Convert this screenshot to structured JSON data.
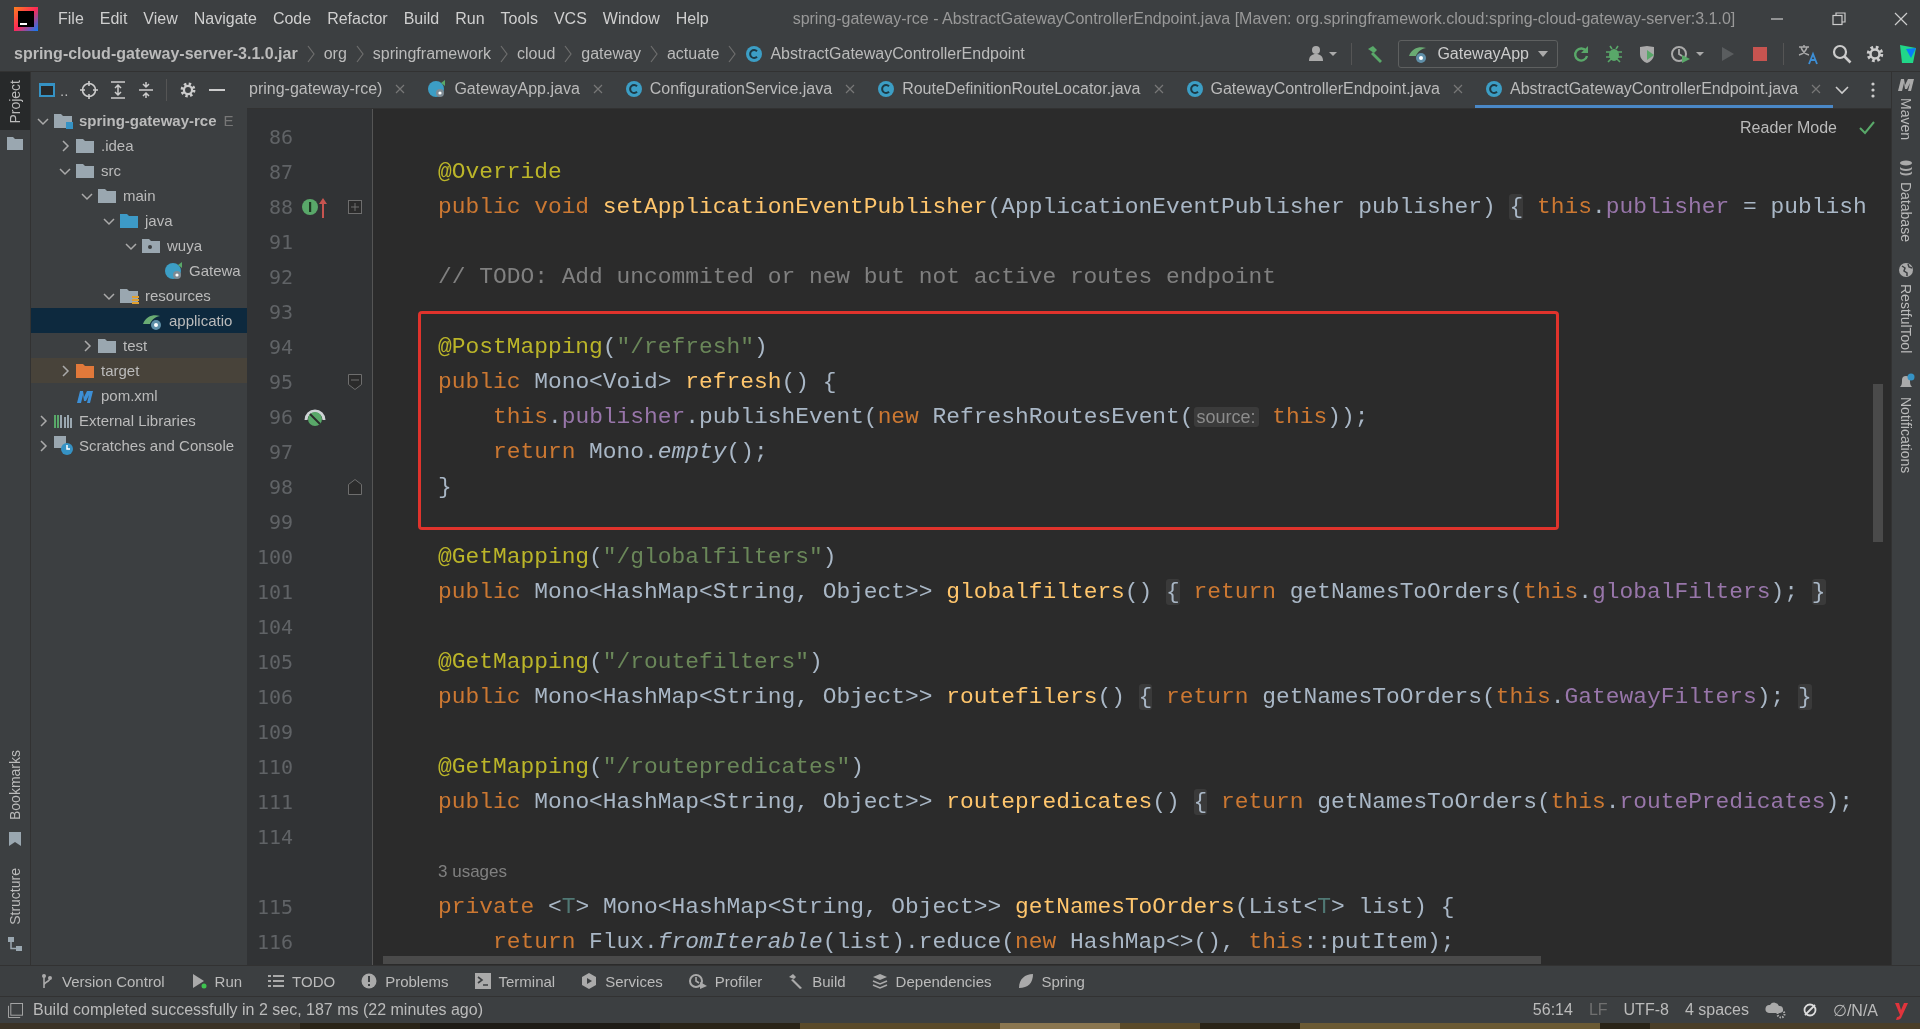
{
  "window": {
    "title": "spring-gateway-rce - AbstractGatewayControllerEndpoint.java [Maven: org.springframework.cloud:spring-cloud-gateway-server:3.1.0]"
  },
  "menu": [
    "File",
    "Edit",
    "View",
    "Navigate",
    "Code",
    "Refactor",
    "Build",
    "Run",
    "Tools",
    "VCS",
    "Window",
    "Help"
  ],
  "breadcrumb": [
    {
      "label": "spring-cloud-gateway-server-3.1.0.jar",
      "kind": "root"
    },
    {
      "label": "org",
      "kind": "package"
    },
    {
      "label": "springframework",
      "kind": "package"
    },
    {
      "label": "cloud",
      "kind": "package"
    },
    {
      "label": "gateway",
      "kind": "package"
    },
    {
      "label": "actuate",
      "kind": "package"
    },
    {
      "label": "AbstractGatewayControllerEndpoint",
      "kind": "class"
    }
  ],
  "run_config": {
    "label": "GatewayApp",
    "run_disabled": true
  },
  "left_strip": {
    "top": [
      {
        "label": "Project",
        "selected": true
      }
    ],
    "bottom": [
      {
        "label": "Bookmarks",
        "selected": false
      },
      {
        "label": "Structure",
        "selected": false
      }
    ]
  },
  "project_panel": {
    "title": "..",
    "tree": [
      {
        "label": "spring-gateway-rce",
        "path": "E",
        "kind": "module",
        "expanded": true,
        "selected": false,
        "children": [
          {
            "label": ".idea",
            "kind": "folder",
            "expanded": false,
            "selected": false
          },
          {
            "label": "src",
            "kind": "folder",
            "expanded": true,
            "selected": false,
            "children": [
              {
                "label": "main",
                "kind": "folder",
                "expanded": true,
                "selected": false,
                "children": [
                  {
                    "label": "java",
                    "kind": "source",
                    "expanded": true,
                    "selected": false,
                    "children": [
                      {
                        "label": "wuya",
                        "kind": "package",
                        "expanded": true,
                        "selected": false,
                        "children": [
                          {
                            "label": "Gatewa",
                            "kind": "app",
                            "selected": false
                          }
                        ]
                      }
                    ]
                  },
                  {
                    "label": "resources",
                    "kind": "resources",
                    "expanded": true,
                    "selected": false,
                    "children": [
                      {
                        "label": "applicatio",
                        "kind": "config",
                        "selected": true
                      }
                    ]
                  }
                ]
              },
              {
                "label": "test",
                "kind": "folder",
                "expanded": false,
                "selected": false
              }
            ]
          },
          {
            "label": "target",
            "kind": "excluded",
            "expanded": false,
            "selected": false
          },
          {
            "label": "pom.xml",
            "kind": "maven",
            "selected": false
          }
        ]
      },
      {
        "label": "External Libraries",
        "kind": "libraries",
        "expanded": false,
        "selected": false
      },
      {
        "label": "Scratches and Console",
        "kind": "scratches",
        "expanded": false,
        "selected": false
      }
    ]
  },
  "tabs": [
    {
      "label": "pring-gateway-rce)",
      "kind": "plain",
      "selected": false
    },
    {
      "label": "GatewayApp.java",
      "kind": "app",
      "selected": false
    },
    {
      "label": "ConfigurationService.java",
      "kind": "class",
      "selected": false
    },
    {
      "label": "RouteDefinitionRouteLocator.java",
      "kind": "class",
      "selected": false
    },
    {
      "label": "GatewayControllerEndpoint.java",
      "kind": "class",
      "selected": false
    },
    {
      "label": "AbstractGatewayControllerEndpoint.java",
      "kind": "class",
      "selected": true
    }
  ],
  "reader_mode": "Reader Mode",
  "code": {
    "lines": [
      {
        "kind": "code",
        "number": "86",
        "boxed": false
      },
      {
        "kind": "code",
        "number": "87",
        "boxed": false,
        "tokens": [
          {
            "kind": "annotation",
            "text": "@Override"
          }
        ]
      },
      {
        "kind": "code",
        "number": "88",
        "boxed": false,
        "gutter_icon": {
          "kind": "implementing"
        },
        "fold_marker": {
          "kind": "collapsed"
        },
        "tokens": [
          {
            "kind": "keyword",
            "text": "public void "
          },
          {
            "kind": "declaration",
            "text": "setApplicationEventPublisher"
          },
          {
            "kind": "plain",
            "text": "(ApplicationEventPublisher publisher) "
          },
          {
            "kind": "fold",
            "text": "{"
          },
          {
            "kind": "keyword",
            "text": " this"
          },
          {
            "kind": "plain",
            "text": "."
          },
          {
            "kind": "field",
            "text": "publisher"
          },
          {
            "kind": "plain",
            "text": " = publish"
          }
        ]
      },
      {
        "kind": "code",
        "number": "91",
        "boxed": false
      },
      {
        "kind": "code",
        "number": "92",
        "boxed": false,
        "tokens": [
          {
            "kind": "comment",
            "text": "// TODO: Add uncommited or new but not active routes endpoint"
          }
        ]
      },
      {
        "kind": "code",
        "number": "93",
        "boxed": false
      },
      {
        "kind": "code",
        "number": "94",
        "boxed": true,
        "tokens": [
          {
            "kind": "annotation",
            "text": "@PostMapping"
          },
          {
            "kind": "plain",
            "text": "("
          },
          {
            "kind": "string",
            "text": "\"/refresh\""
          },
          {
            "kind": "plain",
            "text": ")"
          }
        ]
      },
      {
        "kind": "code",
        "number": "95",
        "boxed": true,
        "fold_marker": {
          "kind": "start"
        },
        "tokens": [
          {
            "kind": "keyword",
            "text": "public "
          },
          {
            "kind": "plain",
            "text": "Mono<Void> "
          },
          {
            "kind": "declaration",
            "text": "refresh"
          },
          {
            "kind": "plain",
            "text": "() {"
          }
        ]
      },
      {
        "kind": "code",
        "number": "96",
        "boxed": true,
        "gutter_icon": {
          "kind": "spring"
        },
        "tokens": [
          {
            "kind": "keyword",
            "text": "    this"
          },
          {
            "kind": "plain",
            "text": "."
          },
          {
            "kind": "field",
            "text": "publisher"
          },
          {
            "kind": "plain",
            "text": ".publishEvent("
          },
          {
            "kind": "keyword",
            "text": "new "
          },
          {
            "kind": "plain",
            "text": "RefreshRoutesEvent("
          },
          {
            "kind": "hint",
            "text": "source:"
          },
          {
            "kind": "keyword",
            "text": " this"
          },
          {
            "kind": "plain",
            "text": "));"
          }
        ]
      },
      {
        "kind": "code",
        "number": "97",
        "boxed": true,
        "tokens": [
          {
            "kind": "keyword",
            "text": "    return "
          },
          {
            "kind": "plain",
            "text": "Mono."
          },
          {
            "kind": "static",
            "text": "empty"
          },
          {
            "kind": "plain",
            "text": "();"
          }
        ]
      },
      {
        "kind": "code",
        "number": "98",
        "boxed": true,
        "fold_marker": {
          "kind": "end"
        },
        "tokens": [
          {
            "kind": "plain",
            "text": "}"
          }
        ]
      },
      {
        "kind": "code",
        "number": "99",
        "boxed": false
      },
      {
        "kind": "code",
        "number": "100",
        "boxed": false,
        "tokens": [
          {
            "kind": "annotation",
            "text": "@GetMapping"
          },
          {
            "kind": "plain",
            "text": "("
          },
          {
            "kind": "string",
            "text": "\"/globalfilters\""
          },
          {
            "kind": "plain",
            "text": ")"
          }
        ]
      },
      {
        "kind": "code",
        "number": "101",
        "boxed": false,
        "tokens": [
          {
            "kind": "keyword",
            "text": "public "
          },
          {
            "kind": "plain",
            "text": "Mono<HashMap<String, Object>> "
          },
          {
            "kind": "declaration",
            "text": "globalfilters"
          },
          {
            "kind": "plain",
            "text": "() "
          },
          {
            "kind": "fold",
            "text": "{"
          },
          {
            "kind": "keyword",
            "text": " return "
          },
          {
            "kind": "plain",
            "text": "getNamesToOrders("
          },
          {
            "kind": "keyword",
            "text": "this"
          },
          {
            "kind": "plain",
            "text": "."
          },
          {
            "kind": "field",
            "text": "globalFilters"
          },
          {
            "kind": "plain",
            "text": "); "
          },
          {
            "kind": "fold",
            "text": "}"
          }
        ]
      },
      {
        "kind": "code",
        "number": "104",
        "boxed": false
      },
      {
        "kind": "code",
        "number": "105",
        "boxed": false,
        "tokens": [
          {
            "kind": "annotation",
            "text": "@GetMapping"
          },
          {
            "kind": "plain",
            "text": "("
          },
          {
            "kind": "string",
            "text": "\"/routefilters\""
          },
          {
            "kind": "plain",
            "text": ")"
          }
        ]
      },
      {
        "kind": "code",
        "number": "106",
        "boxed": false,
        "tokens": [
          {
            "kind": "keyword",
            "text": "public "
          },
          {
            "kind": "plain",
            "text": "Mono<HashMap<String, Object>> "
          },
          {
            "kind": "declaration",
            "text": "routefilers"
          },
          {
            "kind": "plain",
            "text": "() "
          },
          {
            "kind": "fold",
            "text": "{"
          },
          {
            "kind": "keyword",
            "text": " return "
          },
          {
            "kind": "plain",
            "text": "getNamesToOrders("
          },
          {
            "kind": "keyword",
            "text": "this"
          },
          {
            "kind": "plain",
            "text": "."
          },
          {
            "kind": "field",
            "text": "GatewayFilters"
          },
          {
            "kind": "plain",
            "text": "); "
          },
          {
            "kind": "fold",
            "text": "}"
          }
        ]
      },
      {
        "kind": "code",
        "number": "109",
        "boxed": false
      },
      {
        "kind": "code",
        "number": "110",
        "boxed": false,
        "tokens": [
          {
            "kind": "annotation",
            "text": "@GetMapping"
          },
          {
            "kind": "plain",
            "text": "("
          },
          {
            "kind": "string",
            "text": "\"/routepredicates\""
          },
          {
            "kind": "plain",
            "text": ")"
          }
        ]
      },
      {
        "kind": "code",
        "number": "111",
        "boxed": false,
        "tokens": [
          {
            "kind": "keyword",
            "text": "public "
          },
          {
            "kind": "plain",
            "text": "Mono<HashMap<String, Object>> "
          },
          {
            "kind": "declaration",
            "text": "routepredicates"
          },
          {
            "kind": "plain",
            "text": "() "
          },
          {
            "kind": "fold",
            "text": "{"
          },
          {
            "kind": "keyword",
            "text": " return "
          },
          {
            "kind": "plain",
            "text": "getNamesToOrders("
          },
          {
            "kind": "keyword",
            "text": "this"
          },
          {
            "kind": "plain",
            "text": "."
          },
          {
            "kind": "field",
            "text": "routePredicates"
          },
          {
            "kind": "plain",
            "text": ");"
          }
        ]
      },
      {
        "kind": "code",
        "number": "114",
        "boxed": false
      },
      {
        "kind": "usages",
        "text": "3 usages",
        "boxed": false
      },
      {
        "kind": "code",
        "number": "115",
        "boxed": false,
        "tokens": [
          {
            "kind": "keyword",
            "text": "private "
          },
          {
            "kind": "plain",
            "text": "<"
          },
          {
            "kind": "typeparam",
            "text": "T"
          },
          {
            "kind": "plain",
            "text": "> Mono<HashMap<String, Object>> "
          },
          {
            "kind": "declaration",
            "text": "getNamesToOrders"
          },
          {
            "kind": "plain",
            "text": "(List<"
          },
          {
            "kind": "typeparam",
            "text": "T"
          },
          {
            "kind": "plain",
            "text": "> list) {"
          }
        ]
      },
      {
        "kind": "code",
        "number": "116",
        "boxed": false,
        "tokens": [
          {
            "kind": "keyword",
            "text": "    return "
          },
          {
            "kind": "plain",
            "text": "Flux."
          },
          {
            "kind": "static",
            "text": "fromIterable"
          },
          {
            "kind": "plain",
            "text": "(list).reduce("
          },
          {
            "kind": "keyword",
            "text": "new "
          },
          {
            "kind": "plain",
            "text": "HashMap<>(), "
          },
          {
            "kind": "keyword",
            "text": "this"
          },
          {
            "kind": "plain",
            "text": "::putItem);"
          }
        ]
      }
    ]
  },
  "right_strip": [
    {
      "label": "Maven",
      "kind": "maven"
    },
    {
      "label": "Database",
      "kind": "database"
    },
    {
      "label": "RestfulTool",
      "kind": "globe"
    },
    {
      "label": "Notifications",
      "kind": "bell"
    }
  ],
  "tool_windows": [
    {
      "label": "Version Control",
      "kind": "vcs"
    },
    {
      "label": "Run",
      "kind": "run"
    },
    {
      "label": "TODO",
      "kind": "todo"
    },
    {
      "label": "Problems",
      "kind": "problems"
    },
    {
      "label": "Terminal",
      "kind": "terminal"
    },
    {
      "label": "Services",
      "kind": "services"
    },
    {
      "label": "Profiler",
      "kind": "profiler"
    },
    {
      "label": "Build",
      "kind": "build"
    },
    {
      "label": "Dependencies",
      "kind": "dependencies"
    },
    {
      "label": "Spring",
      "kind": "spring"
    }
  ],
  "status_bar": {
    "message": "Build completed successfully in 2 sec, 187 ms (22 minutes ago)",
    "position": "56:14",
    "line_separator": "LF",
    "encoding": "UTF-8",
    "indent": "4 spaces",
    "vcs": "∅/N/A"
  }
}
